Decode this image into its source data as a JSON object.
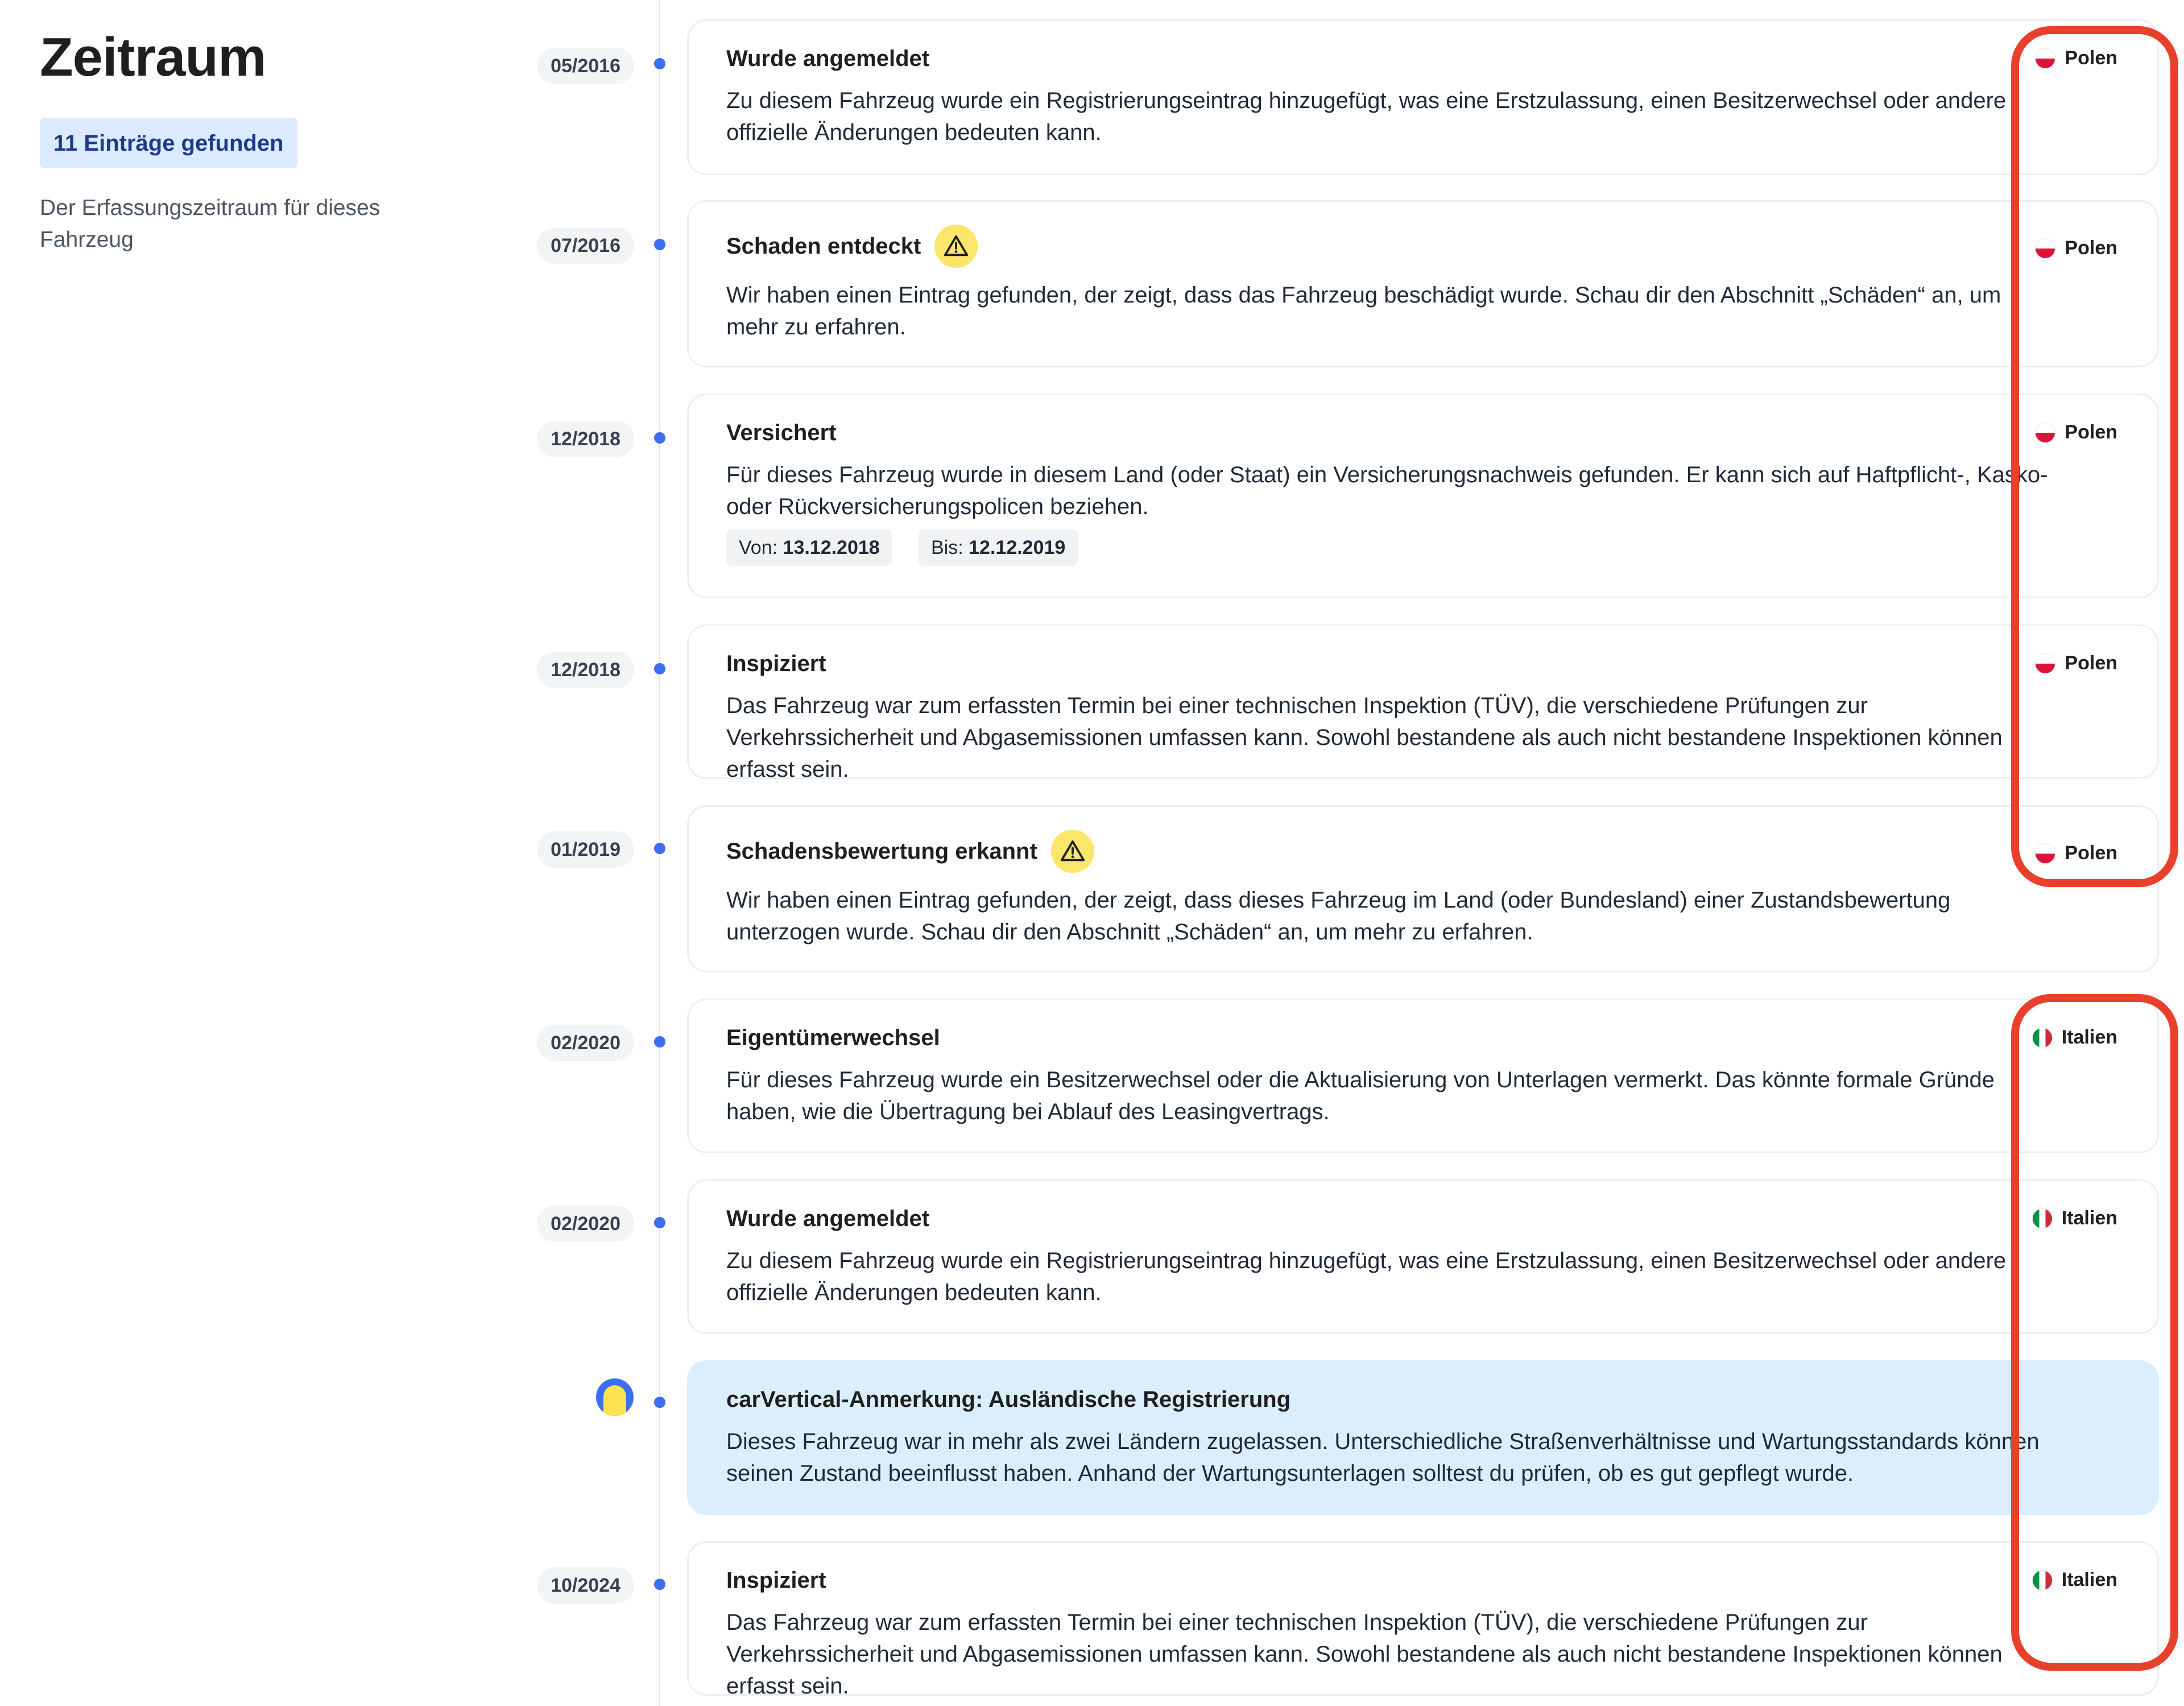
{
  "sidebar": {
    "title": "Zeitraum",
    "count_badge": "11 Einträge gefunden",
    "description": "Der Erfassungszeitraum für dieses Fahrzeug"
  },
  "entries": [
    {
      "date": "05/2016",
      "title": "Wurde angemeldet",
      "country": "Polen",
      "flag": "poland-flag-icon",
      "body": "Zu diesem Fahrzeug wurde ein Registrierungseintrag hinzugefügt, was eine Erstzulassung, einen Besitzerwechsel oder andere offizielle Änderungen bedeuten kann."
    },
    {
      "date": "07/2016",
      "title": "Schaden entdeckt",
      "country": "Polen",
      "flag": "poland-flag-icon",
      "warning": true,
      "body": "Wir haben einen Eintrag gefunden, der zeigt, dass das Fahrzeug beschädigt wurde. Schau dir den Abschnitt „Schäden“ an, um mehr zu erfahren."
    },
    {
      "date": "12/2018",
      "title": "Versichert",
      "country": "Polen",
      "flag": "poland-flag-icon",
      "body": "Für dieses Fahrzeug wurde in diesem Land (oder Staat) ein Versicherungsnachweis gefunden. Er kann sich auf Haftpflicht-, Kasko- oder Rückversicherungspolicen beziehen.",
      "from_label": "Von:",
      "from_value": "13.12.2018",
      "to_label": "Bis:",
      "to_value": "12.12.2019"
    },
    {
      "date": "12/2018",
      "title": "Inspiziert",
      "country": "Polen",
      "flag": "poland-flag-icon",
      "body": "Das Fahrzeug war zum erfassten Termin bei einer technischen Inspektion (TÜV), die verschiedene Prüfungen zur Verkehrssicherheit und Abgasemissionen umfassen kann. Sowohl bestandene als auch nicht bestandene Inspektionen können erfasst sein."
    },
    {
      "date": "01/2019",
      "title": "Schadensbewertung erkannt",
      "country": "Polen",
      "flag": "poland-flag-icon",
      "warning": true,
      "body": "Wir haben einen Eintrag gefunden, der zeigt, dass dieses Fahrzeug im Land (oder Bundesland) einer Zustandsbewertung unterzogen wurde. Schau dir den Abschnitt „Schäden“ an, um mehr zu erfahren."
    },
    {
      "date": "02/2020",
      "title": "Eigentümerwechsel",
      "country": "Italien",
      "flag": "italy-flag-icon",
      "body": "Für dieses Fahrzeug wurde ein Besitzerwechsel oder die Aktualisierung von Unterlagen vermerkt. Das könnte formale Gründe haben, wie die Übertragung bei Ablauf des Leasingvertrags."
    },
    {
      "date": "02/2020",
      "title": "Wurde angemeldet",
      "country": "Italien",
      "flag": "italy-flag-icon",
      "body": "Zu diesem Fahrzeug wurde ein Registrierungseintrag hinzugefügt, was eine Erstzulassung, einen Besitzerwechsel oder andere offizielle Änderungen bedeuten kann."
    },
    {
      "note": true,
      "title": "carVertical-Anmerkung: Ausländische Registrierung",
      "avatar": "carvertical-avatar-icon",
      "body": "Dieses Fahrzeug war in mehr als zwei Ländern zugelassen. Unterschiedliche Straßenverhältnisse und Wartungsstandards können seinen Zustand beeinflusst haben. Anhand der Wartungsunterlagen solltest du prüfen, ob es gut gepflegt wurde."
    },
    {
      "date": "10/2024",
      "title": "Inspiziert",
      "country": "Italien",
      "flag": "italy-flag-icon",
      "body": "Das Fahrzeug war zum erfassten Termin bei einer technischen Inspektion (TÜV), die verschiedene Prüfungen zur Verkehrssicherheit und Abgasemissionen umfassen kann. Sowohl bestandene als auch nicht bestandene Inspektionen können erfasst sein."
    }
  ],
  "colors": {
    "accent_blue": "#3b6ff0",
    "badge_bg": "#dbeafe",
    "note_bg": "#dbeefe",
    "warning_yellow": "#fbe66b",
    "annotation_red": "#e8402a"
  }
}
